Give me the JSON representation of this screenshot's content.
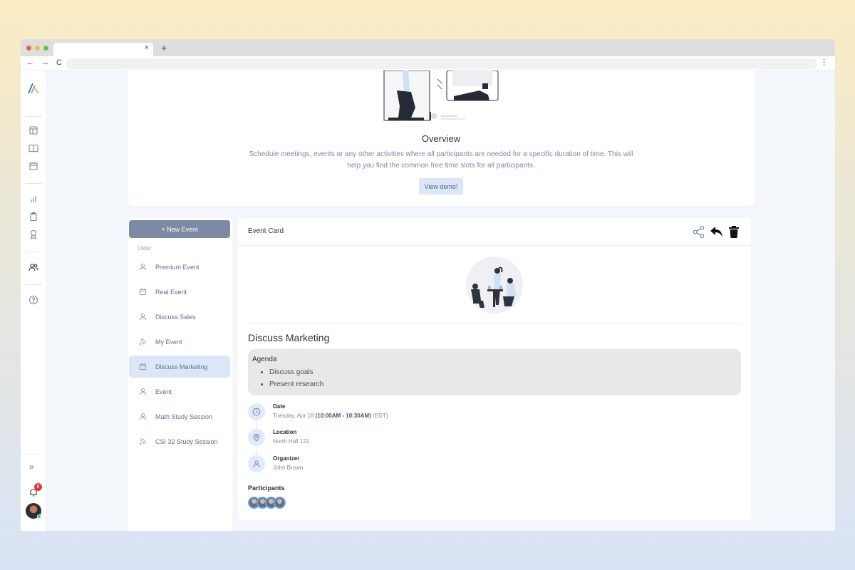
{
  "browser": {
    "nav_back": "←",
    "nav_forward": "→",
    "nav_reload": "C",
    "menu": "⋮",
    "tab_close": "×",
    "new_tab": "+"
  },
  "sidebar": {
    "icons": [
      "logo-icon",
      "layout-icon",
      "book-icon",
      "calendar-icon",
      "chart-icon",
      "clipboard-icon",
      "award-icon",
      "users-icon",
      "help-icon"
    ],
    "expand_icon": "»",
    "notification_count": "6"
  },
  "overview": {
    "title": "Overview",
    "description": "Schedule meetings, events or any other activities where all participants are needed for a specific duration of time. This will help you find the common free time slots for all participants.",
    "demo_button": "View demo!"
  },
  "event_list": {
    "new_event_button": "+ New Event",
    "section_label": "Older",
    "items": [
      {
        "label": "Premium Event",
        "icon": "user-icon"
      },
      {
        "label": "Real Event",
        "icon": "calendar-icon"
      },
      {
        "label": "Discuss Sales",
        "icon": "user-icon"
      },
      {
        "label": "My Event",
        "icon": "rss-icon"
      },
      {
        "label": "Discuss Marketing",
        "icon": "calendar-icon",
        "active": true
      },
      {
        "label": "Event",
        "icon": "user-icon"
      },
      {
        "label": "Math Study Session",
        "icon": "user-icon"
      },
      {
        "label": "CSI 32 Study Session",
        "icon": "rss-icon"
      }
    ]
  },
  "event_card": {
    "header": "Event Card",
    "name": "Discuss Marketing",
    "agenda_title": "Agenda",
    "agenda_items": [
      "Discuss goals",
      "Present research"
    ],
    "date_label": "Date",
    "date_day": "Tuesday, Apr 18",
    "date_time": "(10:00AM - 10:30AM)",
    "date_tz": "(EDT)",
    "location_label": "Location",
    "location_value": "North Hall 121",
    "organizer_label": "Organizer",
    "organizer_value": "John Brown",
    "participants_label": "Participants",
    "participant_count": 4
  },
  "colors": {
    "accent": "#7d8aa5",
    "active_bg": "#dbe6f8",
    "badge": "#e53935"
  }
}
